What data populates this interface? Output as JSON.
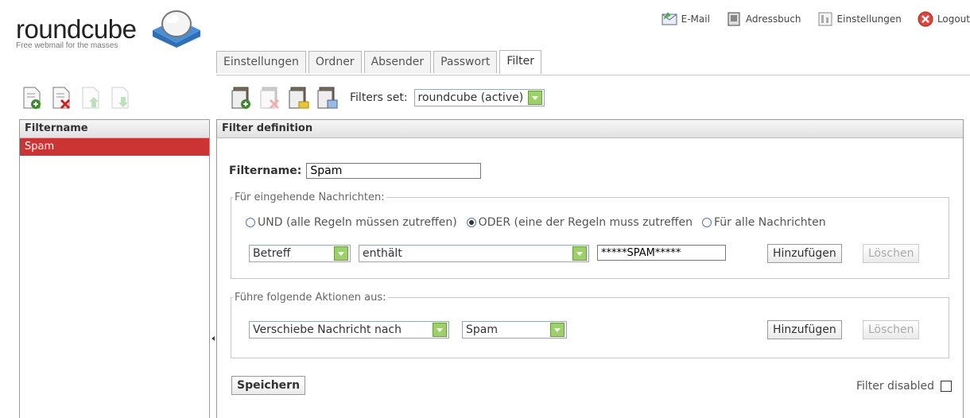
{
  "logo": {
    "name": "roundcube",
    "tagline": "Free webmail for the masses"
  },
  "taskbar": [
    {
      "label": "E-Mail",
      "icon": "mail-icon"
    },
    {
      "label": "Adressbuch",
      "icon": "addressbook-icon"
    },
    {
      "label": "Einstellungen",
      "icon": "settings-icon"
    },
    {
      "label": "Logout",
      "icon": "logout-icon"
    }
  ],
  "tabs": [
    "Einstellungen",
    "Ordner",
    "Absender",
    "Passwort",
    "Filter"
  ],
  "active_tab": "Filter",
  "filters_set": {
    "label": "Filters set:",
    "value": "roundcube (active)"
  },
  "filter_list": {
    "header": "Filtername",
    "items": [
      "Spam"
    ]
  },
  "definition": {
    "header": "Filter definition",
    "name_label": "Filtername:",
    "name_value": "Spam",
    "rules": {
      "legend": "Für eingehende Nachrichten:",
      "options": [
        "UND (alle Regeln müssen zutreffen)",
        "ODER (eine der Regeln muss zutreffen",
        "Für alle Nachrichten"
      ],
      "selected": 1,
      "header_field": "Betreff",
      "operator": "enthält",
      "target": "*****SPAM*****",
      "add": "Hinzufügen",
      "delete": "Löschen"
    },
    "actions": {
      "legend": "Führe folgende Aktionen aus:",
      "action": "Verschiebe Nachricht nach",
      "folder": "Spam",
      "add": "Hinzufügen",
      "delete": "Löschen"
    },
    "save": "Speichern",
    "disabled_label": "Filter disabled",
    "disabled": false
  },
  "colors": {
    "selected_row": "#cc3333",
    "select_arrow": "#9bd06a"
  }
}
